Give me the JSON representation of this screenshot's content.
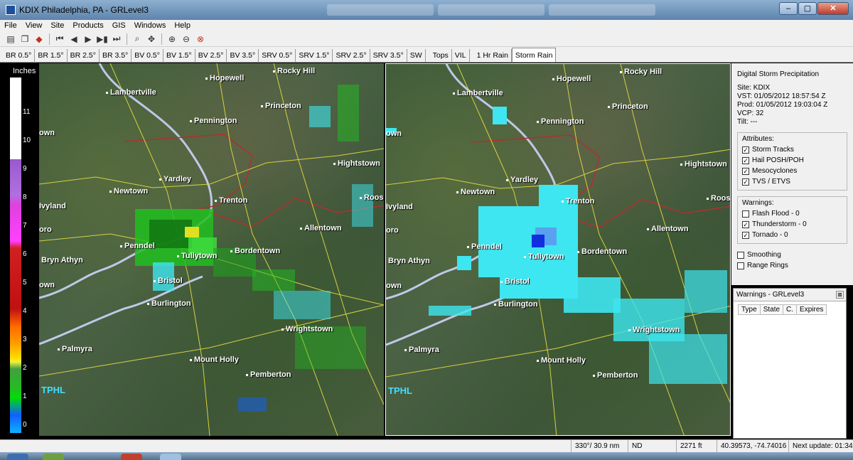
{
  "window": {
    "title": "KDIX Philadelphia, PA - GRLevel3",
    "btn_min": "‒",
    "btn_max": "▢",
    "btn_close": "✕"
  },
  "menu": [
    "File",
    "View",
    "Site",
    "Products",
    "GIS",
    "Windows",
    "Help"
  ],
  "toolbar_icons": [
    "open-icon",
    "copy-icon",
    "colors-icon",
    "first-frame-icon",
    "prev-frame-icon",
    "play-icon",
    "next-frame-icon",
    "last-frame-icon",
    "zoom-icon",
    "pan-icon",
    "zoom-in-icon",
    "zoom-out-icon",
    "zoom-reset-icon"
  ],
  "product_tabs": [
    "BR 0.5°",
    "BR 1.5°",
    "BR 2.5°",
    "BR 3.5°",
    "BV 0.5°",
    "BV 1.5°",
    "BV 2.5°",
    "BV 3.5°",
    "SRV 0.5°",
    "SRV 1.5°",
    "SRV 2.5°",
    "SRV 3.5°",
    "SW",
    "Tops",
    "VIL",
    "1 Hr Rain",
    "Storm Rain"
  ],
  "active_tab": "Storm Rain",
  "legend": {
    "unit": "Inches",
    "ticks": [
      "11",
      "10",
      "9",
      "8",
      "7",
      "6",
      "5",
      "4",
      "3",
      "2",
      "1",
      "0"
    ]
  },
  "map_labels": {
    "hopewell": "Hopewell",
    "rocky_hill": "Rocky Hill",
    "lambertville": "Lambertville",
    "pennington": "Pennington",
    "princeton": "Princeton",
    "town": "own",
    "hightstown": "Hightstown",
    "yardley": "Yardley",
    "newtown": "Newtown",
    "trenton": "Trenton",
    "roos": "Roos",
    "ivyland": "Ivyland",
    "oro": "oro",
    "allentown": "Allentown",
    "penndel": "Penndel",
    "tullytown": "Tullytown",
    "bordentown": "Bordentown",
    "bryn_athyn": "Bryn Athyn",
    "bristol": "Bristol",
    "burlington": "Burlington",
    "wrightstown": "Wrightstown",
    "palmyra": "Palmyra",
    "mount_holly": "Mount Holly",
    "pemberton": "Pemberton",
    "tphl": "TPHL"
  },
  "info": {
    "heading": "Digital Storm Precipitation",
    "site": "Site:  KDIX",
    "vst": "VST:  01/05/2012  18:57:54 Z",
    "prod": "Prod: 01/05/2012  19:03:04 Z",
    "vcp": "VCP:  32",
    "tilt": "Tilt:   ---",
    "attributes_title": "Attributes:",
    "attributes": [
      {
        "label": "Storm Tracks",
        "checked": true
      },
      {
        "label": "Hail POSH/POH",
        "checked": true
      },
      {
        "label": "Mesocyclones",
        "checked": true
      },
      {
        "label": "TVS / ETVS",
        "checked": true
      }
    ],
    "warnings_title": "Warnings:",
    "warnings": [
      {
        "label": "Flash Flood - 0",
        "checked": false
      },
      {
        "label": "Thunderstorm - 0",
        "checked": true
      },
      {
        "label": "Tornado - 0",
        "checked": true
      }
    ],
    "smoothing": "Smoothing",
    "range_rings": "Range Rings"
  },
  "warnings_window": {
    "title": "Warnings - GRLevel3",
    "close": "⊠",
    "columns": [
      "Type",
      "State",
      "C.",
      "Expires"
    ]
  },
  "status": {
    "bearing": "330°/ 30.9 nm",
    "value": "ND",
    "height": "2271 ft",
    "coords": "40.39573, -74.74016",
    "next_update": "Next update: 01:34"
  },
  "colors": {
    "precip_cyan": "#3de6f0",
    "precip_blue": "#1030e0",
    "roads": "#d8d040",
    "borders": "#b03030",
    "river": "#c0c8e8"
  }
}
